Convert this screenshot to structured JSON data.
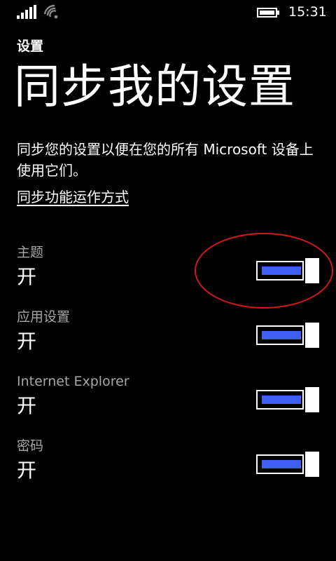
{
  "status_bar": {
    "signal_icon": "signal-bars-icon",
    "wifi_icon": "wifi-icon",
    "battery_icon": "battery-icon",
    "time": "15:31"
  },
  "header": {
    "app_title": "设置",
    "page_title": "同步我的设置"
  },
  "description": "同步您的设置以便在您的所有 Microsoft 设备上使用它们。",
  "how_link": "同步功能运作方式",
  "settings": [
    {
      "label": "主题",
      "state": "开",
      "on": true
    },
    {
      "label": "应用设置",
      "state": "开",
      "on": true
    },
    {
      "label": "Internet Explorer",
      "state": "开",
      "on": true
    },
    {
      "label": "密码",
      "state": "开",
      "on": true
    }
  ],
  "colors": {
    "background": "#000000",
    "toggle_accent": "#3e5ff2",
    "annotation": "#d11a1a",
    "secondary_text": "#a6a6a6"
  }
}
